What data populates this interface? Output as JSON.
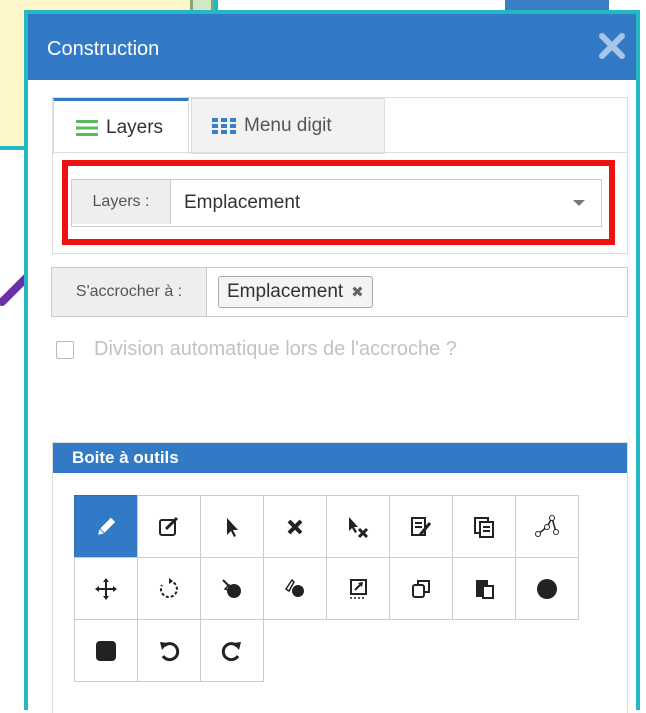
{
  "panel": {
    "title": "Construction",
    "close_icon": "close-icon"
  },
  "tabs": [
    {
      "label": "Layers",
      "icon": "list-icon",
      "active": true
    },
    {
      "label": "Menu digit",
      "icon": "grid-icon",
      "active": false
    }
  ],
  "layers_select": {
    "label": "Layers :",
    "value": "Emplacement"
  },
  "snap": {
    "label": "S'accrocher à :",
    "chip": "Emplacement"
  },
  "auto_split": {
    "label": "Division automatique lors de l'accroche ?",
    "checked": false
  },
  "toolbox": {
    "title": "Boite à outils",
    "tools": [
      {
        "icon": "pencil-icon",
        "active": true
      },
      {
        "icon": "edit-icon",
        "active": false
      },
      {
        "icon": "pointer-icon",
        "active": false
      },
      {
        "icon": "delete-icon",
        "active": false
      },
      {
        "icon": "pointer-delete-icon",
        "active": false
      },
      {
        "icon": "edit-attributes-icon",
        "active": false
      },
      {
        "icon": "copy-attributes-icon",
        "active": false
      },
      {
        "icon": "vertex-icon",
        "active": false
      },
      {
        "icon": "move-icon",
        "active": false
      },
      {
        "icon": "rotate-icon",
        "active": false
      },
      {
        "icon": "split-icon",
        "active": false
      },
      {
        "icon": "cut-icon",
        "active": false
      },
      {
        "icon": "resize-icon",
        "active": false
      },
      {
        "icon": "duplicate-icon",
        "active": false
      },
      {
        "icon": "paste-icon",
        "active": false
      },
      {
        "icon": "circle-icon",
        "active": false
      },
      {
        "icon": "square-icon",
        "active": false
      },
      {
        "icon": "undo-icon",
        "active": false
      },
      {
        "icon": "redo-icon",
        "active": false
      }
    ]
  },
  "colors": {
    "header_blue": "#337ac6",
    "panel_border": "#23b8c4",
    "highlight_red": "#ee1111",
    "arrow_purple": "#6b2fa8",
    "callout_yellow": "#fdf6c8"
  }
}
